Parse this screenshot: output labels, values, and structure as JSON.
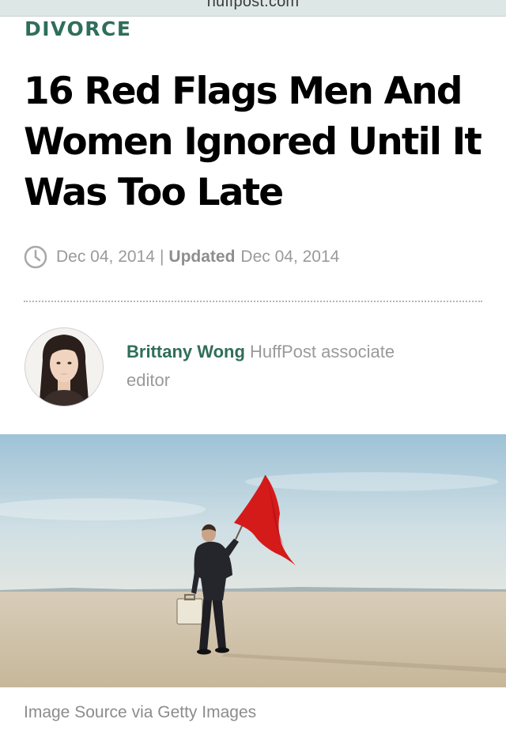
{
  "browser": {
    "url": "huffpost.com"
  },
  "article": {
    "section": "DIVORCE",
    "headline": "16 Red Flags Men And Women Ignored Until It Was Too Late",
    "date": "Dec 04, 2014",
    "separator": "|",
    "updated_label": "Updated",
    "updated_date": "Dec 04, 2014",
    "author": {
      "name": "Brittany Wong",
      "title": "HuffPost associate editor"
    },
    "image": {
      "caption": "Image Source via Getty Images"
    }
  },
  "colors": {
    "accent": "#2f6e5a",
    "meta_text": "#9a9a9a",
    "flag": "#d51a1a"
  },
  "icons": {
    "clock": "clock-icon"
  }
}
